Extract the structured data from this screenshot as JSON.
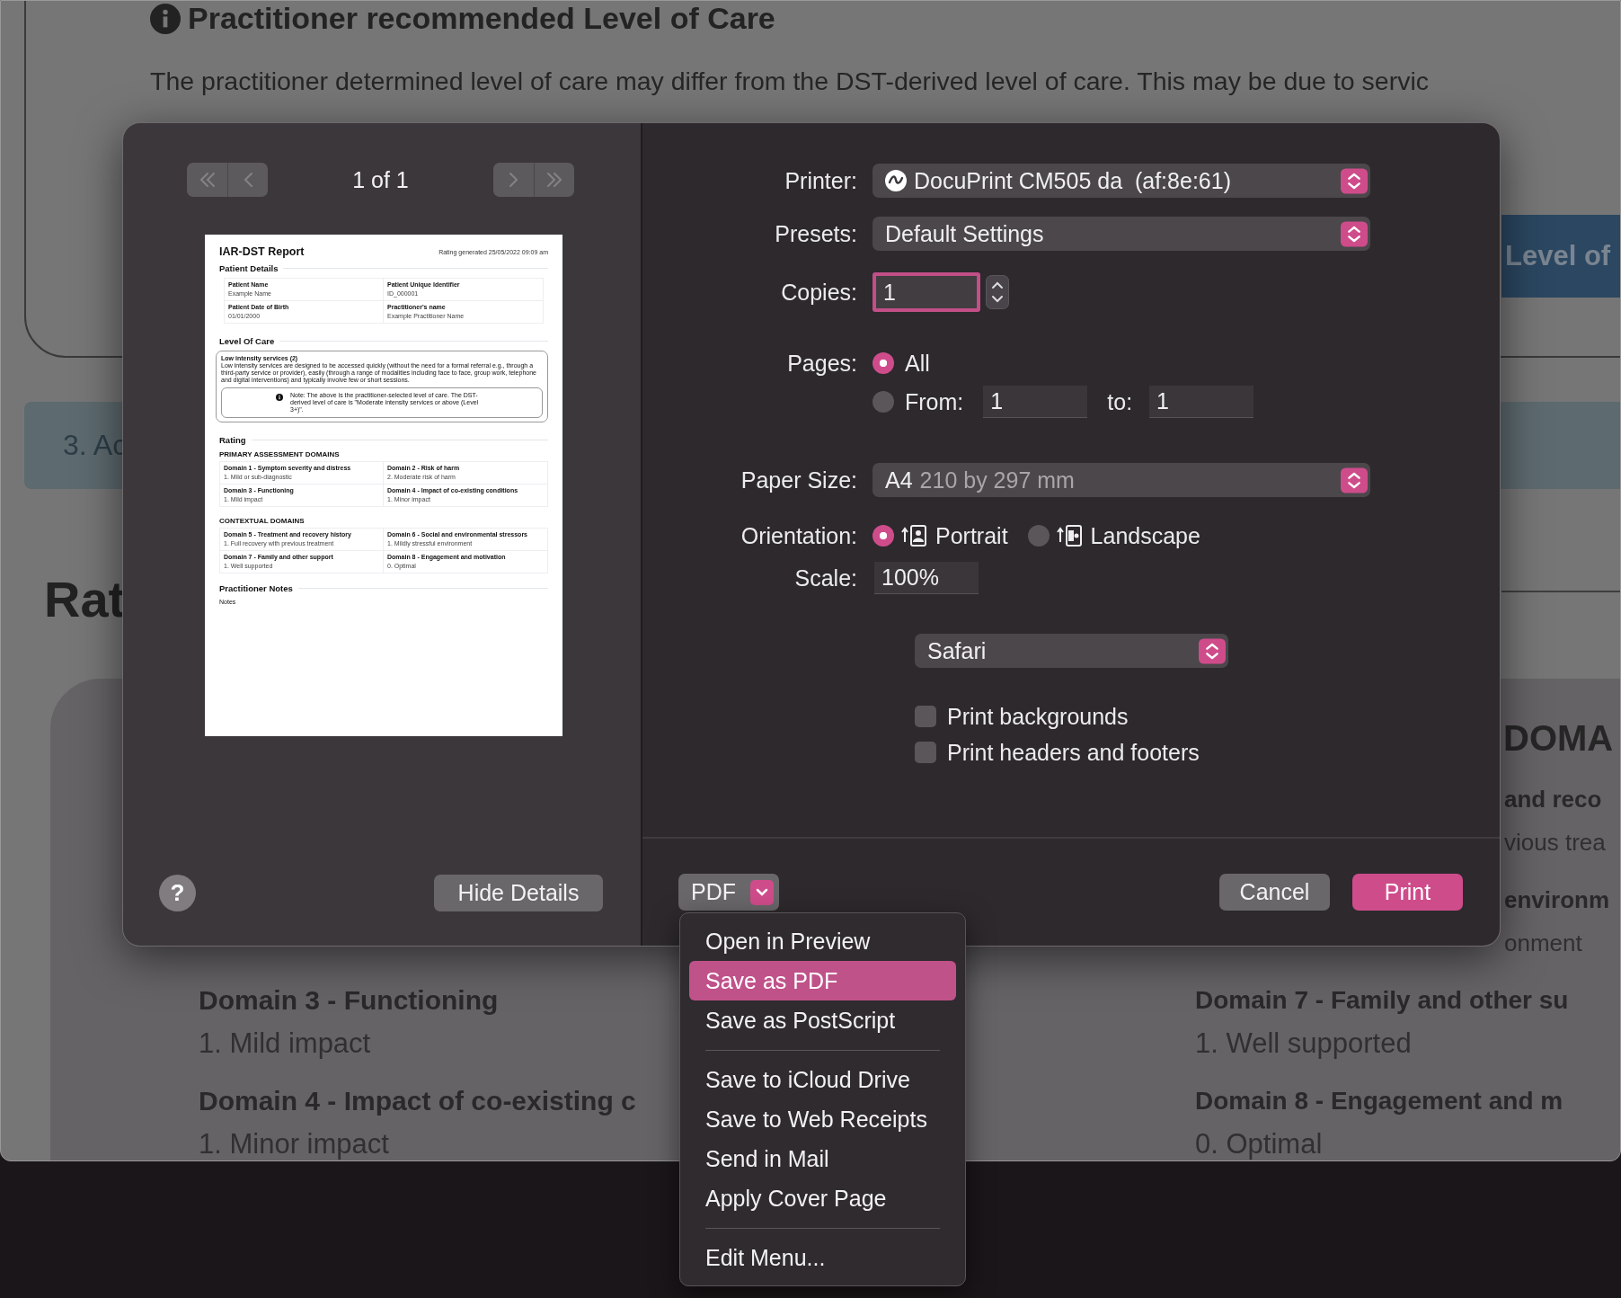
{
  "browser_page": {
    "heading": "Practitioner recommended Level of Care",
    "intro_lines": [
      "The practitioner determined level of care may differ from the DST-derived level of care. This may be due to servic"
    ],
    "level_button": "Level of",
    "section_tab": "3. Ac",
    "rating_heading": "Rat",
    "domain_heading": "DOMA",
    "left_column": [
      {
        "kind": "title",
        "text": "Domain 3 - Functioning"
      },
      {
        "kind": "value",
        "text": "1. Mild impact"
      },
      {
        "kind": "title",
        "text": "Domain 4 - Impact of co-existing c"
      },
      {
        "kind": "value",
        "text": "1. Minor impact"
      }
    ],
    "right_fragments": [
      {
        "kind": "title",
        "text": "and reco"
      },
      {
        "kind": "value",
        "text": "vious trea"
      },
      {
        "kind": "title",
        "text": "environm"
      },
      {
        "kind": "value",
        "text": "onment"
      }
    ],
    "right_column": [
      {
        "kind": "title",
        "text": "Domain 7 - Family and other su"
      },
      {
        "kind": "value",
        "text": "1. Well supported"
      },
      {
        "kind": "title",
        "text": "Domain 8 - Engagement and m"
      },
      {
        "kind": "value",
        "text": "0. Optimal"
      }
    ]
  },
  "print_dialog": {
    "pager": {
      "label": "1 of 1",
      "buttons": [
        {
          "kind": "first",
          "disabled": true
        },
        {
          "kind": "previous",
          "disabled": true
        },
        {
          "kind": "next",
          "disabled": true
        },
        {
          "kind": "last",
          "disabled": true
        }
      ]
    },
    "preview": {
      "title": "IAR-DST Report",
      "generated": "Rating generated 25/05/2022 09:09 am",
      "sections": [
        {
          "kind": "details",
          "heading": "Patient Details",
          "fields": [
            {
              "label": "Patient Name",
              "value": "Example Name"
            },
            {
              "label": "Patient Unique Identifier",
              "value": "ID_000001"
            },
            {
              "label": "Patient Date of Birth",
              "value": "01/01/2000"
            },
            {
              "label": "Practitioner's name",
              "value": "Example Practitioner Name"
            }
          ]
        },
        {
          "kind": "care",
          "heading": "Level Of Care",
          "title": "Low intensity services (2)",
          "text": "Low intensity services are designed to be accessed quickly (without the need for a formal referral e.g., through a third-party service or provider), easily (through a range of modalities including face to face, group work, telephone and digital interventions) and typically involve few or short sessions.",
          "note": "Note: The above is the practitioner-selected level of care. The DST-derived level of care is \"Moderate intensity services or above (Level 3+)\"."
        },
        {
          "kind": "rating",
          "heading": "Rating",
          "groups": [
            {
              "title": "PRIMARY ASSESSMENT DOMAINS",
              "fields": [
                {
                  "label": "Domain 1 - Symptom severity and distress",
                  "value": "1. Mild or sub-diagnostic"
                },
                {
                  "label": "Domain 2 - Risk of harm",
                  "value": "2. Moderate risk of harm"
                },
                {
                  "label": "Domain 3 - Functioning",
                  "value": "1. Mild impact"
                },
                {
                  "label": "Domain 4 - Impact of co-existing conditions",
                  "value": "1. Minor impact"
                }
              ]
            },
            {
              "title": "CONTEXTUAL DOMAINS",
              "fields": [
                {
                  "label": "Domain 5 - Treatment and recovery history",
                  "value": "1. Full recovery with previous treatment"
                },
                {
                  "label": "Domain 6 - Social and environmental stressors",
                  "value": "1. Mildly stressful environment"
                },
                {
                  "label": "Domain 7 - Family and other support",
                  "value": "1. Well supported"
                },
                {
                  "label": "Domain 8 - Engagement and motivation",
                  "value": "0. Optimal"
                }
              ]
            }
          ]
        },
        {
          "kind": "notes",
          "heading": "Practitioner Notes",
          "text": "Notes"
        }
      ]
    },
    "help_button": "?",
    "hide_details_button": "Hide Details",
    "settings": [
      {
        "kind": "printer_popup",
        "label": "Printer:",
        "value": "DocuPrint CM505 da  (af:8e:61)"
      },
      {
        "kind": "popup",
        "label": "Presets:",
        "value": "Default Settings"
      },
      {
        "kind": "copies",
        "label": "Copies:",
        "value": "1",
        "focused": true
      },
      {
        "kind": "radio",
        "label": "Pages:",
        "option": "All",
        "selected": true
      },
      {
        "kind": "range",
        "option": "From:",
        "selected": false,
        "from": "1",
        "to_label": "to:",
        "to": "1"
      },
      {
        "kind": "popup",
        "label": "Paper Size:",
        "value": "A4",
        "detail": "210 by 297 mm"
      },
      {
        "kind": "orientation",
        "label": "Orientation:",
        "options": [
          {
            "label": "Portrait",
            "selected": true
          },
          {
            "label": "Landscape",
            "selected": false
          }
        ]
      },
      {
        "kind": "field",
        "label": "Scale:",
        "value": "100%"
      },
      {
        "kind": "app_popup",
        "value": "Safari"
      },
      {
        "kind": "checkbox",
        "label": "Print backgrounds",
        "checked": false
      },
      {
        "kind": "checkbox",
        "label": "Print headers and footers",
        "checked": false
      }
    ],
    "pdf_button": "PDF",
    "cancel_button": "Cancel",
    "print_button": "Print"
  },
  "pdf_menu": {
    "items": [
      {
        "kind": "item",
        "label": "Open in Preview",
        "selected": false
      },
      {
        "kind": "item",
        "label": "Save as PDF",
        "selected": true
      },
      {
        "kind": "item",
        "label": "Save as PostScript",
        "selected": false
      },
      {
        "kind": "separator"
      },
      {
        "kind": "item",
        "label": "Save to iCloud Drive",
        "selected": false
      },
      {
        "kind": "item",
        "label": "Save to Web Receipts",
        "selected": false
      },
      {
        "kind": "item",
        "label": "Send in Mail",
        "selected": false
      },
      {
        "kind": "item",
        "label": "Apply Cover Page",
        "selected": false
      },
      {
        "kind": "separator"
      },
      {
        "kind": "item",
        "label": "Edit Menu...",
        "selected": false
      }
    ]
  }
}
